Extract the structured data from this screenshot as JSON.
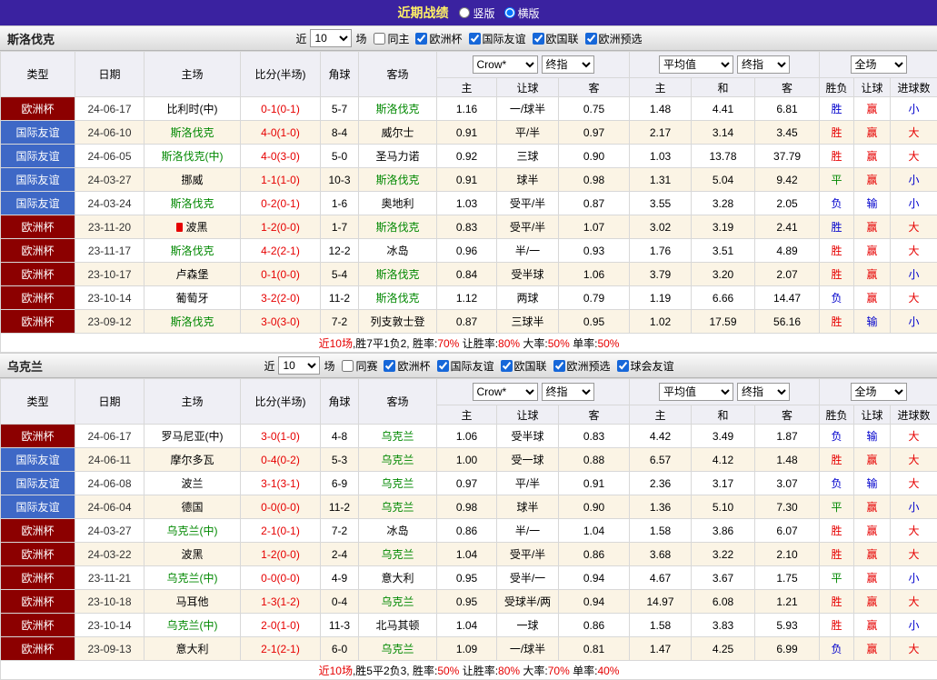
{
  "header": {
    "title": "近期战绩",
    "layout_options": [
      {
        "label": "竖版",
        "selected": false
      },
      {
        "label": "横版",
        "selected": true
      }
    ]
  },
  "colors": {
    "topbar_bg": "#3A22A0",
    "title_text": "#FFF066",
    "euro_cup_bg": "#8C0000",
    "friendly_bg": "#3E68C6",
    "focal_team": "#008800",
    "score_text": "#E60000",
    "lose_text": "#0000CC",
    "draw_text": "#008800",
    "row_alt_bg": "#FBF4E5",
    "header_bg": "#EFEFF5"
  },
  "table_headers": {
    "static": [
      "类型",
      "日期",
      "主场",
      "比分(半场)",
      "角球",
      "客场"
    ],
    "group1": [
      "主",
      "让球",
      "客"
    ],
    "group2": [
      "主",
      "和",
      "客"
    ],
    "group3": [
      "胜负",
      "让球",
      "进球数"
    ],
    "dropdowns": {
      "company": "Crow*",
      "company_stage": "终指",
      "average": "平均值",
      "average_stage": "终指",
      "scope": "全场"
    }
  },
  "sections": [
    {
      "team": "斯洛伐克",
      "filter": {
        "prefix": "近",
        "count": "10",
        "suffix": "场",
        "same": {
          "label": "同主",
          "checked": false
        },
        "competitions": [
          {
            "label": "欧洲杯",
            "checked": true
          },
          {
            "label": "国际友谊",
            "checked": true
          },
          {
            "label": "欧国联",
            "checked": true
          },
          {
            "label": "欧洲预选",
            "checked": true
          }
        ]
      },
      "rows": [
        {
          "type": "欧洲杯",
          "type_key": "euro",
          "date": "24-06-17",
          "home": "比利时(中)",
          "home_green": false,
          "score": "0-1(0-1)",
          "corner": "5-7",
          "away": "斯洛伐克",
          "away_green": true,
          "odds": [
            "1.16",
            "一/球半",
            "0.75",
            "1.48",
            "4.41",
            "6.81"
          ],
          "results": [
            [
              "胜",
              "blue"
            ],
            [
              "赢",
              "red"
            ],
            [
              "小",
              "blue"
            ]
          ]
        },
        {
          "type": "国际友谊",
          "type_key": "friendly",
          "date": "24-06-10",
          "home": "斯洛伐克",
          "home_green": true,
          "score": "4-0(1-0)",
          "corner": "8-4",
          "away": "威尔士",
          "away_green": false,
          "odds": [
            "0.91",
            "平/半",
            "0.97",
            "2.17",
            "3.14",
            "3.45"
          ],
          "results": [
            [
              "胜",
              "red"
            ],
            [
              "赢",
              "red"
            ],
            [
              "大",
              "red"
            ]
          ]
        },
        {
          "type": "国际友谊",
          "type_key": "friendly",
          "date": "24-06-05",
          "home": "斯洛伐克(中)",
          "home_green": true,
          "score": "4-0(3-0)",
          "corner": "5-0",
          "away": "圣马力诺",
          "away_green": false,
          "odds": [
            "0.92",
            "三球",
            "0.90",
            "1.03",
            "13.78",
            "37.79"
          ],
          "results": [
            [
              "胜",
              "red"
            ],
            [
              "赢",
              "red"
            ],
            [
              "大",
              "red"
            ]
          ]
        },
        {
          "type": "国际友谊",
          "type_key": "friendly",
          "date": "24-03-27",
          "home": "挪威",
          "home_green": false,
          "score": "1-1(1-0)",
          "corner": "10-3",
          "away": "斯洛伐克",
          "away_green": true,
          "odds": [
            "0.91",
            "球半",
            "0.98",
            "1.31",
            "5.04",
            "9.42"
          ],
          "results": [
            [
              "平",
              "green"
            ],
            [
              "赢",
              "red"
            ],
            [
              "小",
              "blue"
            ]
          ]
        },
        {
          "type": "国际友谊",
          "type_key": "friendly",
          "date": "24-03-24",
          "home": "斯洛伐克",
          "home_green": true,
          "score": "0-2(0-1)",
          "corner": "1-6",
          "away": "奥地利",
          "away_green": false,
          "odds": [
            "1.03",
            "受平/半",
            "0.87",
            "3.55",
            "3.28",
            "2.05"
          ],
          "results": [
            [
              "负",
              "blue"
            ],
            [
              "输",
              "blue"
            ],
            [
              "小",
              "blue"
            ]
          ]
        },
        {
          "type": "欧洲杯",
          "type_key": "euro",
          "date": "23-11-20",
          "home": "波黑",
          "home_green": false,
          "home_icon": "red-card",
          "score": "1-2(0-0)",
          "corner": "1-7",
          "away": "斯洛伐克",
          "away_green": true,
          "odds": [
            "0.83",
            "受平/半",
            "1.07",
            "3.02",
            "3.19",
            "2.41"
          ],
          "results": [
            [
              "胜",
              "blue"
            ],
            [
              "赢",
              "red"
            ],
            [
              "大",
              "red"
            ]
          ]
        },
        {
          "type": "欧洲杯",
          "type_key": "euro",
          "date": "23-11-17",
          "home": "斯洛伐克",
          "home_green": true,
          "score": "4-2(2-1)",
          "corner": "12-2",
          "away": "冰岛",
          "away_green": false,
          "odds": [
            "0.96",
            "半/一",
            "0.93",
            "1.76",
            "3.51",
            "4.89"
          ],
          "results": [
            [
              "胜",
              "red"
            ],
            [
              "赢",
              "red"
            ],
            [
              "大",
              "red"
            ]
          ]
        },
        {
          "type": "欧洲杯",
          "type_key": "euro",
          "date": "23-10-17",
          "home": "卢森堡",
          "home_green": false,
          "score": "0-1(0-0)",
          "corner": "5-4",
          "away": "斯洛伐克",
          "away_green": true,
          "odds": [
            "0.84",
            "受半球",
            "1.06",
            "3.79",
            "3.20",
            "2.07"
          ],
          "results": [
            [
              "胜",
              "red"
            ],
            [
              "赢",
              "red"
            ],
            [
              "小",
              "blue"
            ]
          ]
        },
        {
          "type": "欧洲杯",
          "type_key": "euro",
          "date": "23-10-14",
          "home": "葡萄牙",
          "home_green": false,
          "score": "3-2(2-0)",
          "corner": "11-2",
          "away": "斯洛伐克",
          "away_green": true,
          "odds": [
            "1.12",
            "两球",
            "0.79",
            "1.19",
            "6.66",
            "14.47"
          ],
          "results": [
            [
              "负",
              "blue"
            ],
            [
              "赢",
              "red"
            ],
            [
              "大",
              "red"
            ]
          ]
        },
        {
          "type": "欧洲杯",
          "type_key": "euro",
          "date": "23-09-12",
          "home": "斯洛伐克",
          "home_green": true,
          "score": "3-0(3-0)",
          "corner": "7-2",
          "away": "列支敦士登",
          "away_green": false,
          "odds": [
            "0.87",
            "三球半",
            "0.95",
            "1.02",
            "17.59",
            "56.16"
          ],
          "results": [
            [
              "胜",
              "red"
            ],
            [
              "输",
              "blue"
            ],
            [
              "小",
              "blue"
            ]
          ]
        }
      ],
      "summary": [
        {
          "text": "近10场",
          "color": "red"
        },
        {
          "text": ",胜7平1负2, ",
          "color": "black"
        },
        {
          "text": "胜率:",
          "color": "black"
        },
        {
          "text": "70%",
          "color": "red"
        },
        {
          "text": " 让胜率:",
          "color": "black"
        },
        {
          "text": "80%",
          "color": "red"
        },
        {
          "text": " 大率:",
          "color": "black"
        },
        {
          "text": "50%",
          "color": "red"
        },
        {
          "text": " 单率:",
          "color": "black"
        },
        {
          "text": "50%",
          "color": "red"
        }
      ]
    },
    {
      "team": "乌克兰",
      "filter": {
        "prefix": "近",
        "count": "10",
        "suffix": "场",
        "same": {
          "label": "同赛",
          "checked": false
        },
        "competitions": [
          {
            "label": "欧洲杯",
            "checked": true
          },
          {
            "label": "国际友谊",
            "checked": true
          },
          {
            "label": "欧国联",
            "checked": true
          },
          {
            "label": "欧洲预选",
            "checked": true
          },
          {
            "label": "球会友谊",
            "checked": true
          }
        ]
      },
      "rows": [
        {
          "type": "欧洲杯",
          "type_key": "euro",
          "date": "24-06-17",
          "home": "罗马尼亚(中)",
          "home_green": false,
          "score": "3-0(1-0)",
          "corner": "4-8",
          "away": "乌克兰",
          "away_green": true,
          "odds": [
            "1.06",
            "受半球",
            "0.83",
            "4.42",
            "3.49",
            "1.87"
          ],
          "results": [
            [
              "负",
              "blue"
            ],
            [
              "输",
              "blue"
            ],
            [
              "大",
              "red"
            ]
          ]
        },
        {
          "type": "国际友谊",
          "type_key": "friendly",
          "date": "24-06-11",
          "home": "摩尔多瓦",
          "home_green": false,
          "score": "0-4(0-2)",
          "corner": "5-3",
          "away": "乌克兰",
          "away_green": true,
          "odds": [
            "1.00",
            "受一球",
            "0.88",
            "6.57",
            "4.12",
            "1.48"
          ],
          "results": [
            [
              "胜",
              "red"
            ],
            [
              "赢",
              "red"
            ],
            [
              "大",
              "red"
            ]
          ]
        },
        {
          "type": "国际友谊",
          "type_key": "friendly",
          "date": "24-06-08",
          "home": "波兰",
          "home_green": false,
          "score": "3-1(3-1)",
          "corner": "6-9",
          "away": "乌克兰",
          "away_green": true,
          "odds": [
            "0.97",
            "平/半",
            "0.91",
            "2.36",
            "3.17",
            "3.07"
          ],
          "results": [
            [
              "负",
              "blue"
            ],
            [
              "输",
              "blue"
            ],
            [
              "大",
              "red"
            ]
          ]
        },
        {
          "type": "国际友谊",
          "type_key": "friendly",
          "date": "24-06-04",
          "home": "德国",
          "home_green": false,
          "score": "0-0(0-0)",
          "corner": "11-2",
          "away": "乌克兰",
          "away_green": true,
          "odds": [
            "0.98",
            "球半",
            "0.90",
            "1.36",
            "5.10",
            "7.30"
          ],
          "results": [
            [
              "平",
              "green"
            ],
            [
              "赢",
              "red"
            ],
            [
              "小",
              "blue"
            ]
          ]
        },
        {
          "type": "欧洲杯",
          "type_key": "euro",
          "date": "24-03-27",
          "home": "乌克兰(中)",
          "home_green": true,
          "score": "2-1(0-1)",
          "corner": "7-2",
          "away": "冰岛",
          "away_green": false,
          "odds": [
            "0.86",
            "半/一",
            "1.04",
            "1.58",
            "3.86",
            "6.07"
          ],
          "results": [
            [
              "胜",
              "red"
            ],
            [
              "赢",
              "red"
            ],
            [
              "大",
              "red"
            ]
          ]
        },
        {
          "type": "欧洲杯",
          "type_key": "euro",
          "date": "24-03-22",
          "home": "波黑",
          "home_green": false,
          "score": "1-2(0-0)",
          "corner": "2-4",
          "away": "乌克兰",
          "away_green": true,
          "odds": [
            "1.04",
            "受平/半",
            "0.86",
            "3.68",
            "3.22",
            "2.10"
          ],
          "results": [
            [
              "胜",
              "red"
            ],
            [
              "赢",
              "red"
            ],
            [
              "大",
              "red"
            ]
          ]
        },
        {
          "type": "欧洲杯",
          "type_key": "euro",
          "date": "23-11-21",
          "home": "乌克兰(中)",
          "home_green": true,
          "score": "0-0(0-0)",
          "corner": "4-9",
          "away": "意大利",
          "away_green": false,
          "odds": [
            "0.95",
            "受半/一",
            "0.94",
            "4.67",
            "3.67",
            "1.75"
          ],
          "results": [
            [
              "平",
              "green"
            ],
            [
              "赢",
              "red"
            ],
            [
              "小",
              "blue"
            ]
          ]
        },
        {
          "type": "欧洲杯",
          "type_key": "euro",
          "date": "23-10-18",
          "home": "马耳他",
          "home_green": false,
          "score": "1-3(1-2)",
          "corner": "0-4",
          "away": "乌克兰",
          "away_green": true,
          "odds": [
            "0.95",
            "受球半/两",
            "0.94",
            "14.97",
            "6.08",
            "1.21"
          ],
          "results": [
            [
              "胜",
              "red"
            ],
            [
              "赢",
              "red"
            ],
            [
              "大",
              "red"
            ]
          ]
        },
        {
          "type": "欧洲杯",
          "type_key": "euro",
          "date": "23-10-14",
          "home": "乌克兰(中)",
          "home_green": true,
          "score": "2-0(1-0)",
          "corner": "11-3",
          "away": "北马其顿",
          "away_green": false,
          "odds": [
            "1.04",
            "一球",
            "0.86",
            "1.58",
            "3.83",
            "5.93"
          ],
          "results": [
            [
              "胜",
              "red"
            ],
            [
              "赢",
              "red"
            ],
            [
              "小",
              "blue"
            ]
          ]
        },
        {
          "type": "欧洲杯",
          "type_key": "euro",
          "date": "23-09-13",
          "home": "意大利",
          "home_green": false,
          "score": "2-1(2-1)",
          "corner": "6-0",
          "away": "乌克兰",
          "away_green": true,
          "odds": [
            "1.09",
            "一/球半",
            "0.81",
            "1.47",
            "4.25",
            "6.99"
          ],
          "results": [
            [
              "负",
              "blue"
            ],
            [
              "赢",
              "red"
            ],
            [
              "大",
              "red"
            ]
          ]
        }
      ],
      "summary": [
        {
          "text": "近10场",
          "color": "red"
        },
        {
          "text": ",胜5平2负3, ",
          "color": "black"
        },
        {
          "text": "胜率:",
          "color": "black"
        },
        {
          "text": "50%",
          "color": "red"
        },
        {
          "text": " 让胜率:",
          "color": "black"
        },
        {
          "text": "80%",
          "color": "red"
        },
        {
          "text": " 大率:",
          "color": "black"
        },
        {
          "text": "70%",
          "color": "red"
        },
        {
          "text": " 单率:",
          "color": "black"
        },
        {
          "text": "40%",
          "color": "red"
        }
      ]
    }
  ]
}
